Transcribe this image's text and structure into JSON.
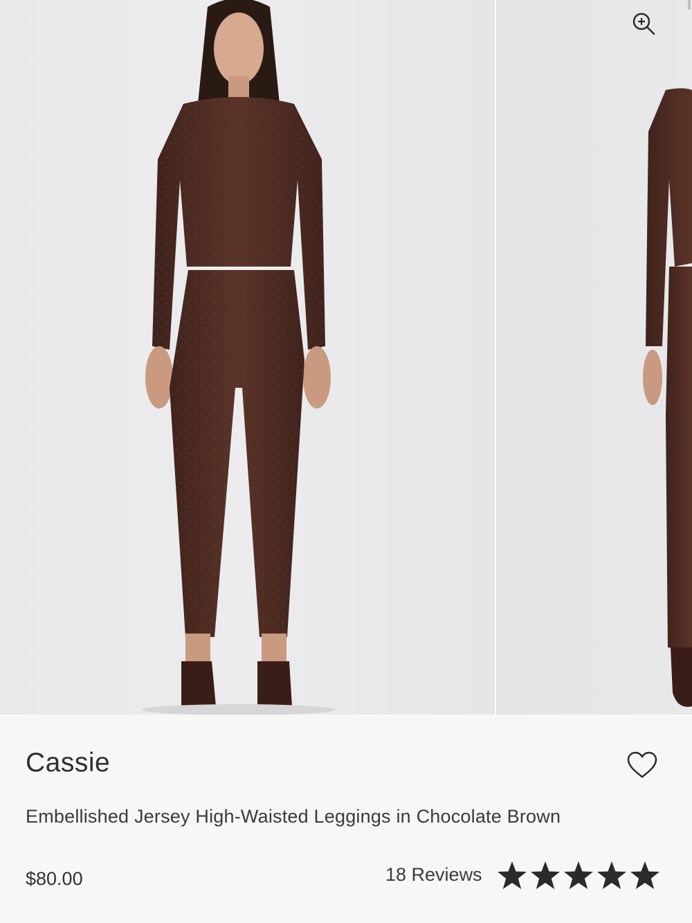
{
  "product": {
    "brand": "Cassie",
    "title": "Embellished Jersey High-Waisted Leggings in Chocolate Brown",
    "price": "$80.00",
    "reviews_label": "18 Reviews",
    "rating": 5,
    "rating_max": 5
  },
  "gallery": {
    "zoom_icon": "zoom-in-icon",
    "wishlist_icon": "heart-outline-icon",
    "star_icon": "star-filled-icon"
  },
  "colors": {
    "garment": "#4a2a22",
    "background": "#e9e9eb",
    "text": "#2f2f2f"
  }
}
